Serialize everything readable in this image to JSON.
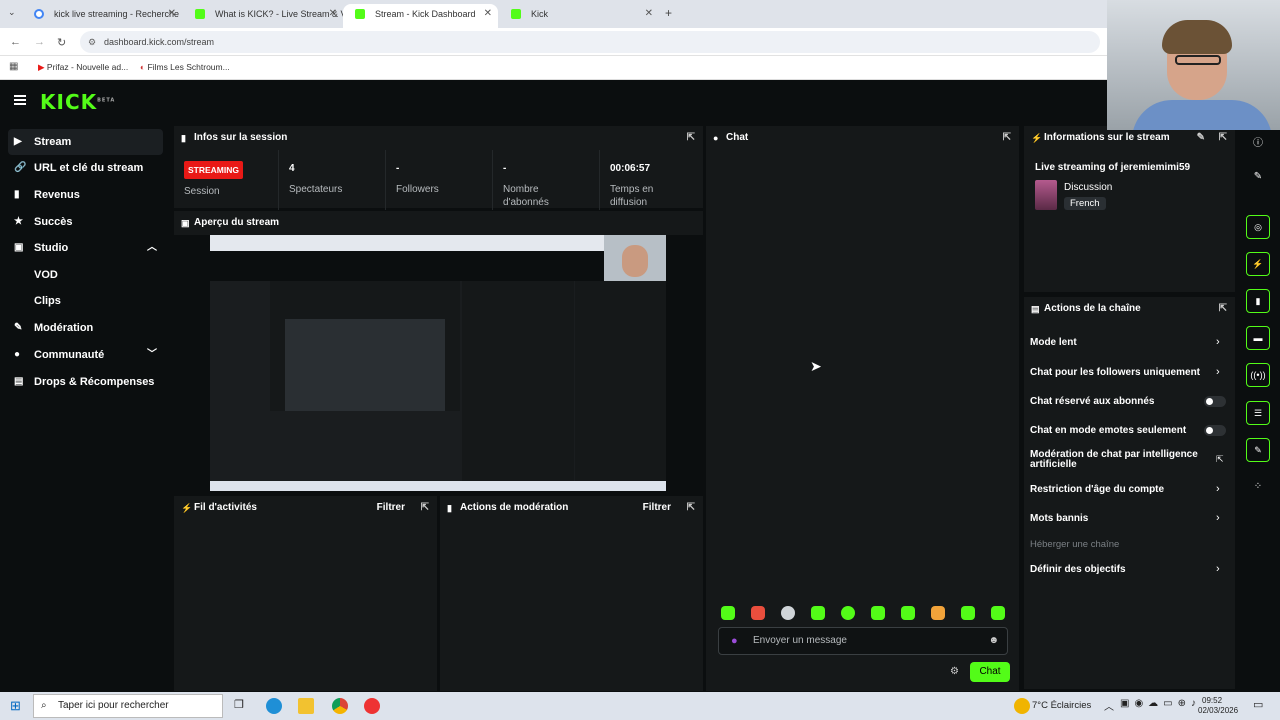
{
  "browser": {
    "tabs": [
      {
        "title": "kick live streaming - Recherche"
      },
      {
        "title": "What is KICK? - Live Stream & V"
      },
      {
        "title": "Stream - Kick Dashboard"
      },
      {
        "title": "Kick"
      }
    ],
    "url": "dashboard.kick.com/stream",
    "bookmarks": [
      "Prifaz - Nouvelle ad...",
      "Films Les Schtroum..."
    ]
  },
  "header": {
    "logo": "KICK",
    "logo_badge": "BETA"
  },
  "sidebar": {
    "items": [
      {
        "label": "Stream",
        "icon": "play-icon"
      },
      {
        "label": "URL et clé du stream",
        "icon": "link-icon"
      },
      {
        "label": "Revenus",
        "icon": "revenue-icon"
      },
      {
        "label": "Succès",
        "icon": "trophy-icon"
      },
      {
        "label": "Studio",
        "icon": "studio-icon"
      },
      {
        "label": "VOD"
      },
      {
        "label": "Clips"
      },
      {
        "label": "Modération",
        "icon": "wrench-icon"
      },
      {
        "label": "Communauté",
        "icon": "community-icon"
      },
      {
        "label": "Drops & Récompenses",
        "icon": "gift-icon"
      }
    ]
  },
  "session": {
    "title": "Infos sur la session",
    "status_badge": "STREAMING",
    "stats": [
      {
        "value": "",
        "label": "Session"
      },
      {
        "value": "4",
        "label": "Spectateurs"
      },
      {
        "value": "-",
        "label": "Followers"
      },
      {
        "value": "-",
        "label": "Nombre d'abonnés"
      },
      {
        "value": "00:06:57",
        "label": "Temps en diffusion"
      }
    ]
  },
  "preview": {
    "title": "Aperçu du stream"
  },
  "activity": {
    "title": "Fil d'activités",
    "filter": "Filtrer"
  },
  "moderation": {
    "title": "Actions de modération",
    "filter": "Filtrer"
  },
  "chat": {
    "title": "Chat",
    "placeholder": "Envoyer un message",
    "send_label": "Chat"
  },
  "stream_info": {
    "title": "Informations sur le stream",
    "stream_title": "Live streaming of jeremiemimi59",
    "category": "Discussion",
    "language": "French"
  },
  "channel_actions": {
    "title": "Actions de la chaîne",
    "items": [
      {
        "label": "Mode lent",
        "control": "arrow"
      },
      {
        "label": "Chat pour les followers uniquement",
        "control": "arrow"
      },
      {
        "label": "Chat réservé aux abonnés",
        "control": "toggle",
        "on": false
      },
      {
        "label": "Chat en mode emotes seulement",
        "control": "toggle",
        "on": false
      },
      {
        "label": "Modération de chat par intelligence artificielle",
        "control": "external"
      },
      {
        "label": "Restriction d'âge du compte",
        "control": "arrow"
      },
      {
        "label": "Mots bannis",
        "control": "arrow"
      },
      {
        "label": "Héberger une chaîne",
        "control": "none",
        "disabled": true
      },
      {
        "label": "Définir des objectifs",
        "control": "arrow"
      }
    ]
  },
  "taskbar": {
    "search_placeholder": "Taper ici pour rechercher",
    "weather": "7°C Éclaircies",
    "time": "09:52",
    "date": "02/03/2026"
  },
  "colors": {
    "accent": "#53fc18",
    "streaming": "#e91916",
    "background": "#0b0e0f",
    "panel": "#151819"
  }
}
